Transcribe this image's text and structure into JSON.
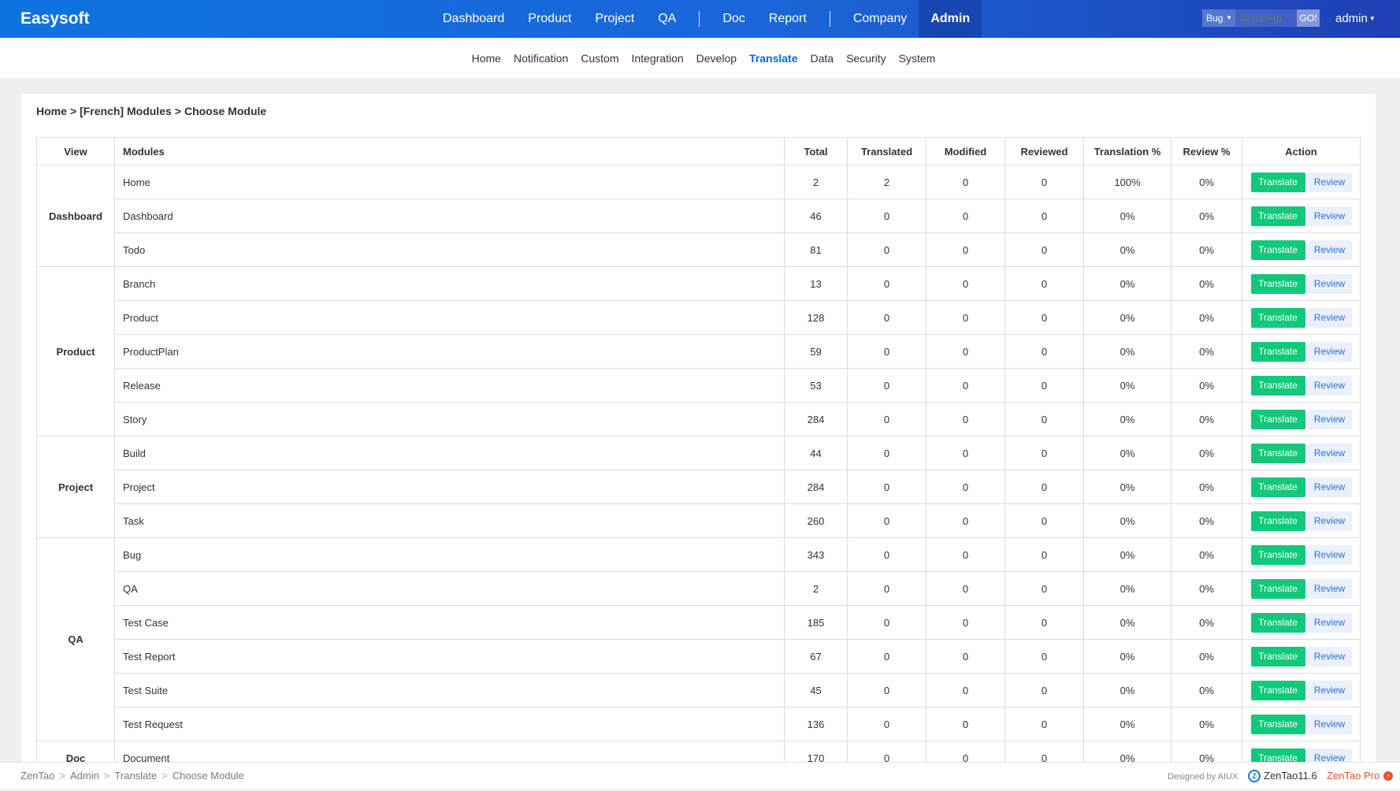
{
  "header": {
    "brand": "Easysoft",
    "nav": [
      "Dashboard",
      "Product",
      "Project",
      "QA",
      "Doc",
      "Report",
      "Company",
      "Admin"
    ],
    "search": {
      "type": "Bug",
      "placeholder": "ID (ctrl+g)",
      "go": "GO!"
    },
    "user": "admin"
  },
  "subnav": [
    "Home",
    "Notification",
    "Custom",
    "Integration",
    "Develop",
    "Translate",
    "Data",
    "Security",
    "System"
  ],
  "breadcrumb": {
    "home": "Home",
    "lang": "[French] Modules",
    "page": "Choose Module"
  },
  "table": {
    "headers": {
      "view": "View",
      "modules": "Modules",
      "total": "Total",
      "translated": "Translated",
      "modified": "Modified",
      "reviewed": "Reviewed",
      "translation_pct": "Translation %",
      "review_pct": "Review %",
      "action": "Action"
    },
    "translate_label": "Translate",
    "review_label": "Review",
    "groups": [
      {
        "view": "Dashboard",
        "rows": [
          [
            "Home",
            "2",
            "2",
            "0",
            "0",
            "100%",
            "0%"
          ],
          [
            "Dashboard",
            "46",
            "0",
            "0",
            "0",
            "0%",
            "0%"
          ],
          [
            "Todo",
            "81",
            "0",
            "0",
            "0",
            "0%",
            "0%"
          ]
        ]
      },
      {
        "view": "Product",
        "rows": [
          [
            "Branch",
            "13",
            "0",
            "0",
            "0",
            "0%",
            "0%"
          ],
          [
            "Product",
            "128",
            "0",
            "0",
            "0",
            "0%",
            "0%"
          ],
          [
            "ProductPlan",
            "59",
            "0",
            "0",
            "0",
            "0%",
            "0%"
          ],
          [
            "Release",
            "53",
            "0",
            "0",
            "0",
            "0%",
            "0%"
          ],
          [
            "Story",
            "284",
            "0",
            "0",
            "0",
            "0%",
            "0%"
          ]
        ]
      },
      {
        "view": "Project",
        "rows": [
          [
            "Build",
            "44",
            "0",
            "0",
            "0",
            "0%",
            "0%"
          ],
          [
            "Project",
            "284",
            "0",
            "0",
            "0",
            "0%",
            "0%"
          ],
          [
            "Task",
            "260",
            "0",
            "0",
            "0",
            "0%",
            "0%"
          ]
        ]
      },
      {
        "view": "QA",
        "rows": [
          [
            "Bug",
            "343",
            "0",
            "0",
            "0",
            "0%",
            "0%"
          ],
          [
            "QA",
            "2",
            "0",
            "0",
            "0",
            "0%",
            "0%"
          ],
          [
            "Test Case",
            "185",
            "0",
            "0",
            "0",
            "0%",
            "0%"
          ],
          [
            "Test Report",
            "67",
            "0",
            "0",
            "0",
            "0%",
            "0%"
          ],
          [
            "Test Suite",
            "45",
            "0",
            "0",
            "0",
            "0%",
            "0%"
          ],
          [
            "Test Request",
            "136",
            "0",
            "0",
            "0",
            "0%",
            "0%"
          ]
        ]
      },
      {
        "view": "Doc",
        "rows": [
          [
            "Document",
            "170",
            "0",
            "0",
            "0",
            "0%",
            "0%"
          ]
        ]
      }
    ]
  },
  "footer": {
    "crumbs": [
      "ZenTao",
      "Admin",
      "Translate",
      "Choose Module"
    ],
    "designed": "Designed by AIUX",
    "version": "ZenTao11.6",
    "pro": "ZenTao Pro"
  },
  "colors": {
    "header": "#1a66d8",
    "active_nav": "#1747b0",
    "translate_btn": "#12c87a",
    "review_btn_text": "#2a6fe0",
    "active_subnav": "#0c64eb"
  }
}
